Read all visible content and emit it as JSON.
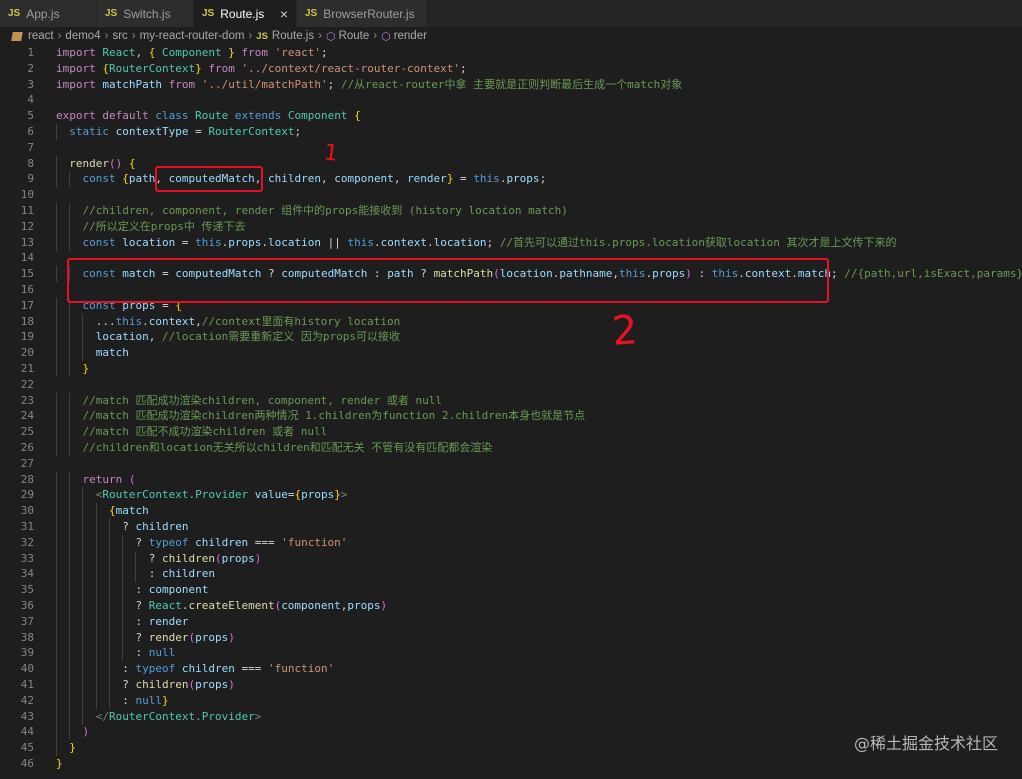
{
  "tabs": [
    {
      "icon": "JS",
      "label": "App.js",
      "active": false
    },
    {
      "icon": "JS",
      "label": "Switch.js",
      "active": false
    },
    {
      "icon": "JS",
      "label": "Route.js",
      "active": true,
      "close": "×"
    },
    {
      "icon": "JS",
      "label": "BrowserRouter.js",
      "active": false
    }
  ],
  "breadcrumb": {
    "items": [
      "react",
      "demo4",
      "src",
      "my-react-router-dom",
      "Route.js",
      "Route",
      "render"
    ],
    "separator": "›"
  },
  "annotations": {
    "one": "1",
    "two": "2"
  },
  "watermark": "@稀土掘金技术社区",
  "line_numbers": [
    "1",
    "2",
    "3",
    "4",
    "5",
    "6",
    "7",
    "8",
    "9",
    "10",
    "11",
    "12",
    "13",
    "14",
    "15",
    "16",
    "17",
    "18",
    "19",
    "20",
    "21",
    "22",
    "23",
    "24",
    "25",
    "26",
    "27",
    "28",
    "29",
    "30",
    "31",
    "32",
    "33",
    "34",
    "35",
    "36",
    "37",
    "38",
    "39",
    "40",
    "41",
    "42",
    "43",
    "44",
    "45",
    "46"
  ],
  "code_lines": [
    "import React, { Component } from 'react';",
    "import {RouterContext} from '../context/react-router-context';",
    "import matchPath from '../util/matchPath'; //从react-router中拿 主要就是正则判断最后生成一个match对象",
    "",
    "export default class Route extends Component {",
    "  static contextType = RouterContext;",
    "",
    "  render() {",
    "    const {path, computedMatch, children, component, render} = this.props;",
    "",
    "    //children, component, render 组件中的props能接收到 (history location match)",
    "    //所以定义在props中 传递下去",
    "    const location = this.props.location || this.context.location; //首先可以通过this.props.location获取location 其次才是上文传下来的",
    "",
    "    const match = computedMatch ? computedMatch : path ? matchPath(location.pathname,this.props) : this.context.match; //{path,url,isExact,params}",
    "",
    "    const props = {",
    "      ...this.context,//context里面有history location",
    "      location, //location需要重新定义 因为props可以接收",
    "      match",
    "    }",
    "",
    "    //match 匹配成功渲染children, component, render 或者 null",
    "    //match 匹配成功渲染children两种情况 1.children为function 2.children本身也就是节点",
    "    //match 匹配不成功渲染children 或者 null",
    "    //children和location无关所以children和匹配无关 不管有没有匹配都会渲染",
    "",
    "    return (",
    "      <RouterContext.Provider value={props}>",
    "        {match",
    "          ? children",
    "            ? typeof children === 'function'",
    "              ? children(props)",
    "              : children",
    "            : component",
    "            ? React.createElement(component,props)",
    "            : render",
    "            ? render(props)",
    "            : null",
    "          : typeof children === 'function'",
    "          ? children(props)",
    "          : null}",
    "      </RouterContext.Provider>",
    "    )",
    "  }",
    "}"
  ],
  "colors": {
    "annotation_red": "#e81123",
    "editor_bg": "#1e1e1e"
  }
}
